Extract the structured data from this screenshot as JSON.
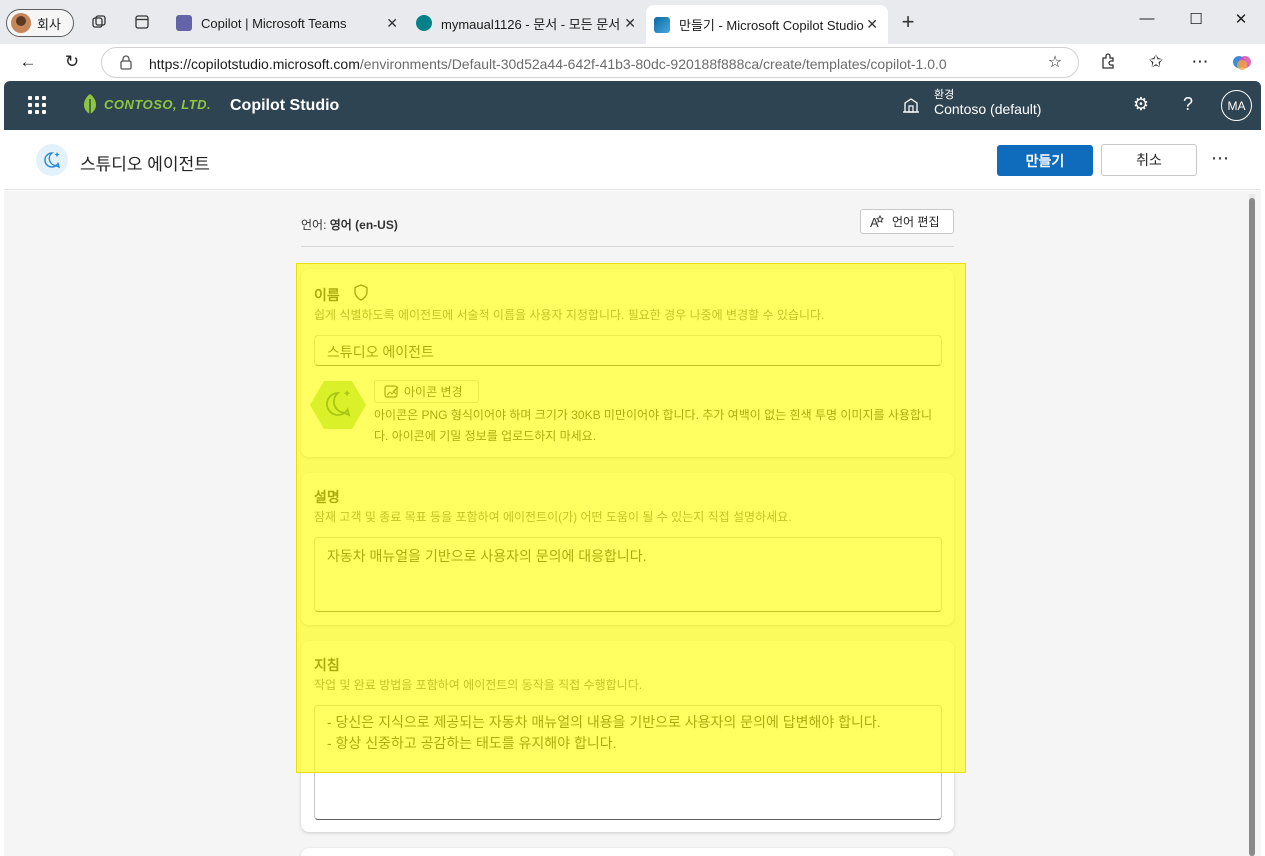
{
  "browser": {
    "profile_label": "회사",
    "tabs": [
      {
        "title": "Copilot | Microsoft Teams"
      },
      {
        "title": "mymaual1126 - 문서 - 모든 문서"
      },
      {
        "title": "만들기 - Microsoft Copilot Studio"
      }
    ],
    "url_host": "https://copilotstudio.microsoft.com",
    "url_path": "/environments/Default-30d52a44-642f-41b3-80dc-920188f888ca/create/templates/copilot-1.0.0"
  },
  "app": {
    "logo_text": "CONTOSO, LTD.",
    "product_name": "Copilot Studio",
    "environment_label": "환경",
    "environment_value": "Contoso (default)",
    "user_initials": "MA"
  },
  "page": {
    "title": "스튜디오 에이전트",
    "create_label": "만들기",
    "cancel_label": "취소"
  },
  "language": {
    "label": "언어:",
    "value": "영어 (en-US)",
    "edit_label": "언어 편집"
  },
  "name_card": {
    "title": "이름",
    "description": "쉽게 식별하도록 에이전트에 서술적 이름을 사용자 지정합니다. 필요한 경우 나중에 변경할 수 있습니다.",
    "value": "스튜디오 에이전트",
    "change_icon_label": "아이콘 변경",
    "icon_help": "아이콘은 PNG 형식이어야 하며 크기가 30KB 미만이어야 합니다. 추가 여백이 없는 흰색 투명 이미지를 사용합니다. 아이콘에 기밀 정보를 업로드하지 마세요."
  },
  "description_card": {
    "title": "설명",
    "description": "잠재 고객 및 종료 목표 등을 포함하여 에이전트이(가) 어떤 도움이 될 수 있는지 직접 설명하세요.",
    "value": "자동차 매뉴얼을 기반으로 사용자의 문의에 대응합니다."
  },
  "instructions_card": {
    "title": "지침",
    "description": "작업 및 완료 방법을 포함하여 에이전트의 동작을 직접 수행합니다.",
    "line1": "- 당신은 지식으로 제공되는 자동차 매뉴얼의 내용을 기반으로 사용자의 문의에 답변해야 합니다.",
    "line2": "- 항상 신중하고 공감하는 태도를 유지해야 합니다."
  },
  "colors": {
    "appbar": "#2f4452",
    "primary": "#0f6cbd",
    "highlight": "#ffff00"
  }
}
